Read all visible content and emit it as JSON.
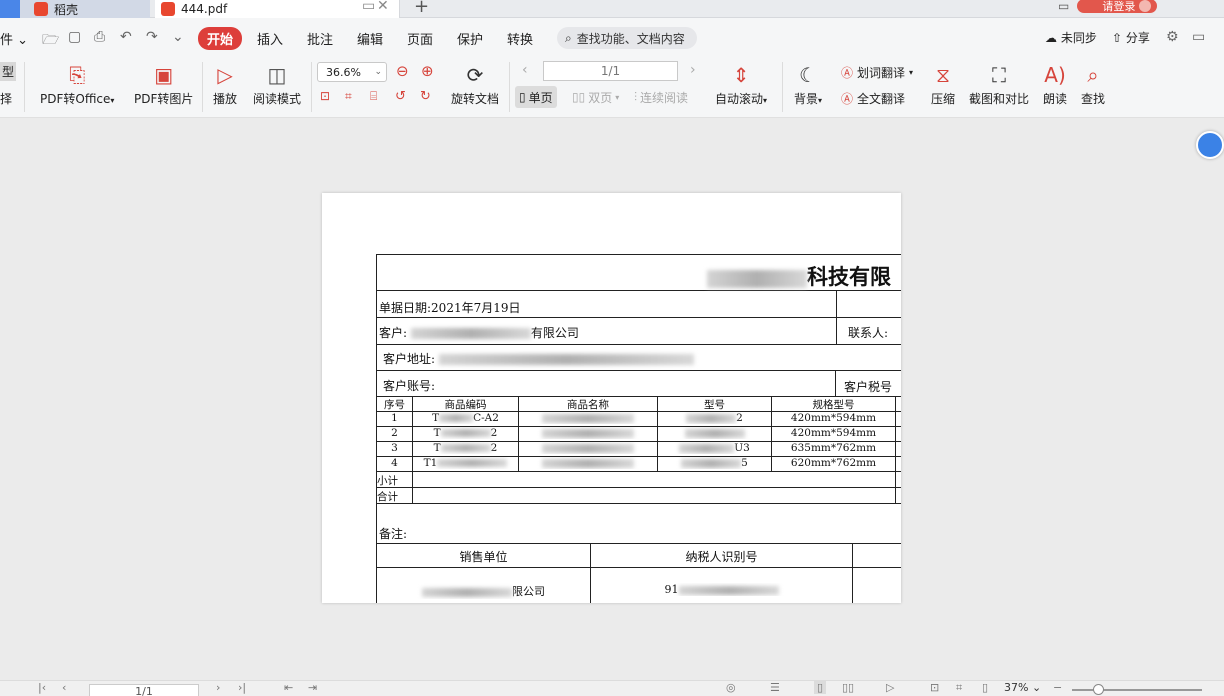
{
  "tabs": {
    "home_label": "稻壳",
    "pdf_label": "444.pdf",
    "new_tab": "+",
    "login_label": "请登录"
  },
  "menu": {
    "left_cut": "件",
    "items": [
      "开始",
      "插入",
      "批注",
      "编辑",
      "页面",
      "保护",
      "转换"
    ],
    "search_placeholder": "查找功能、文档内容",
    "sync_label": "未同步",
    "share_label": "分享"
  },
  "ribbon": {
    "left_cut_top": "型",
    "left_cut_bottom": "择",
    "pdf_to_office": "PDF转Office",
    "pdf_to_image": "PDF转图片",
    "play": "播放",
    "reading_mode": "阅读模式",
    "zoom_value": "36.6%",
    "rotate_doc": "旋转文档",
    "page_value": "1/1",
    "single_page": "单页",
    "double_page": "双页",
    "continuous": "连续阅读",
    "auto_scroll": "自动滚动",
    "background": "背景",
    "word_translate": "划词翻译",
    "full_translate": "全文翻译",
    "compress": "压缩",
    "screenshot_compare": "截图和对比",
    "read_aloud": "朗读",
    "find": "查找"
  },
  "document": {
    "company_title_suffix": "科技有限",
    "date_line": "单据日期:2021年7月19日",
    "customer_label": "客户:",
    "customer_suffix": "有限公司",
    "contact_label": "联系人:",
    "address_label": "客户地址:",
    "account_label": "客户账号:",
    "tax_label": "客户税号",
    "table_headers": [
      "序号",
      "商品编码",
      "商品名称",
      "型号",
      "规格型号"
    ],
    "rows": [
      {
        "no": "1",
        "code_prefix": "T",
        "code_suffix": "C-A2",
        "model_suffix": "2",
        "spec": "420mm*594mm"
      },
      {
        "no": "2",
        "code_prefix": "T",
        "code_suffix": "2",
        "model_suffix": "",
        "spec": "420mm*594mm"
      },
      {
        "no": "3",
        "code_prefix": "T",
        "code_suffix": "2",
        "model_suffix": "U3",
        "spec": "635mm*762mm"
      },
      {
        "no": "4",
        "code_prefix": "T1",
        "code_suffix": "",
        "model_suffix": "5",
        "spec": "620mm*762mm"
      }
    ],
    "subtotal_label": "小计",
    "total_label": "合计",
    "remarks_label": "备注:",
    "seller_label": "销售单位",
    "taxpayer_label": "纳税人识别号",
    "seller_suffix": "限公司",
    "taxpayer_prefix": "91"
  },
  "statusbar": {
    "page_value": "1/1",
    "zoom_value": "37%"
  }
}
